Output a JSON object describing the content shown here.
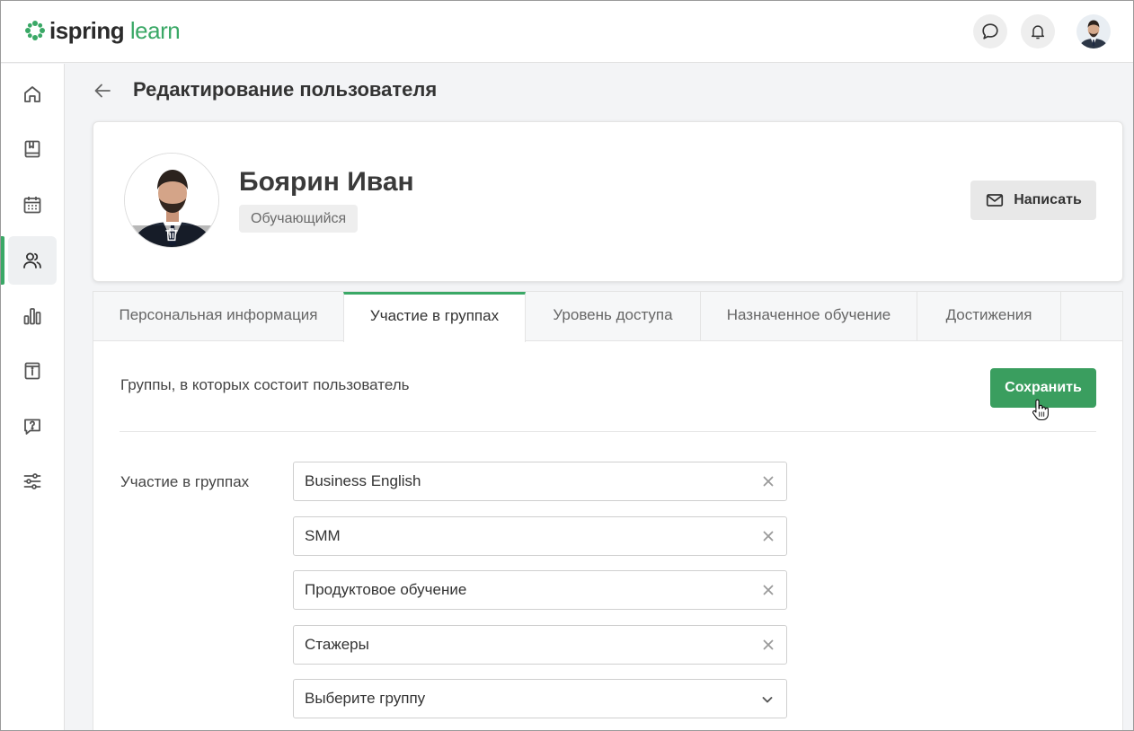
{
  "app": {
    "logo_word1": "ispring",
    "logo_word2": "learn",
    "accent_color": "#3aa866"
  },
  "header": {
    "icons": [
      "chat-icon",
      "bell-icon",
      "user-avatar"
    ]
  },
  "sidebar": {
    "items": [
      {
        "icon": "home-icon",
        "active": false
      },
      {
        "icon": "book-icon",
        "active": false
      },
      {
        "icon": "calendar-icon",
        "active": false
      },
      {
        "icon": "users-icon",
        "active": true
      },
      {
        "icon": "bar-chart-icon",
        "active": false
      },
      {
        "icon": "info-book-icon",
        "active": false
      },
      {
        "icon": "question-bubble-icon",
        "active": false
      },
      {
        "icon": "sliders-icon",
        "active": false
      }
    ]
  },
  "page": {
    "title": "Редактирование пользователя"
  },
  "profile": {
    "name": "Боярин Иван",
    "role": "Обучающийся",
    "write_label": "Написать"
  },
  "tabs": [
    {
      "label": "Персональная информация",
      "active": false
    },
    {
      "label": "Участие в группах",
      "active": true
    },
    {
      "label": "Уровень доступа",
      "active": false
    },
    {
      "label": "Назначенное обучение",
      "active": false
    },
    {
      "label": "Достижения",
      "active": false
    }
  ],
  "groups_section": {
    "description": "Группы, в которых состоит пользователь",
    "save_label": "Сохранить",
    "field_label": "Участие в группах",
    "groups": [
      "Business English",
      "SMM",
      "Продуктовое обучение",
      "Стажеры"
    ],
    "select_placeholder": "Выберите группу"
  }
}
